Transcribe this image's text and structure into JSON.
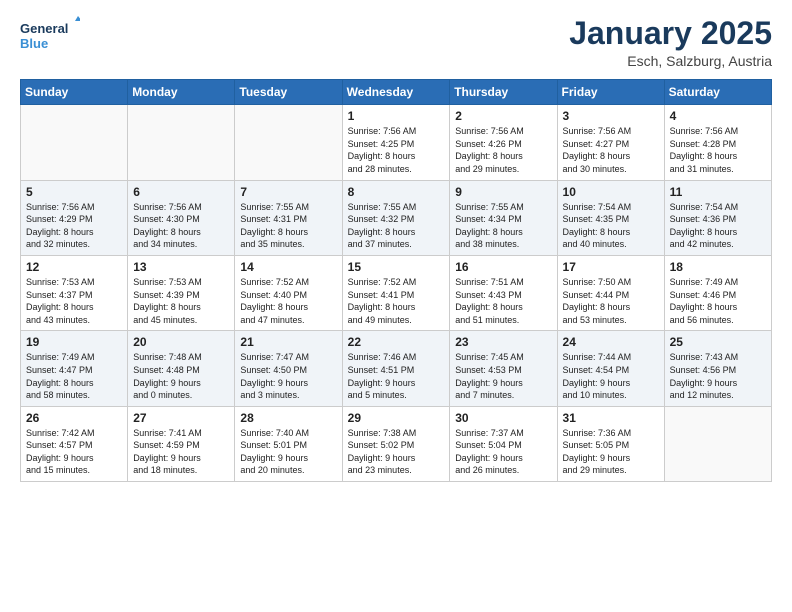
{
  "app": {
    "name_general": "General",
    "name_blue": "Blue",
    "month": "January 2025",
    "location": "Esch, Salzburg, Austria"
  },
  "weekdays": [
    "Sunday",
    "Monday",
    "Tuesday",
    "Wednesday",
    "Thursday",
    "Friday",
    "Saturday"
  ],
  "weeks": [
    [
      {
        "day": "",
        "info": ""
      },
      {
        "day": "",
        "info": ""
      },
      {
        "day": "",
        "info": ""
      },
      {
        "day": "1",
        "info": "Sunrise: 7:56 AM\nSunset: 4:25 PM\nDaylight: 8 hours\nand 28 minutes."
      },
      {
        "day": "2",
        "info": "Sunrise: 7:56 AM\nSunset: 4:26 PM\nDaylight: 8 hours\nand 29 minutes."
      },
      {
        "day": "3",
        "info": "Sunrise: 7:56 AM\nSunset: 4:27 PM\nDaylight: 8 hours\nand 30 minutes."
      },
      {
        "day": "4",
        "info": "Sunrise: 7:56 AM\nSunset: 4:28 PM\nDaylight: 8 hours\nand 31 minutes."
      }
    ],
    [
      {
        "day": "5",
        "info": "Sunrise: 7:56 AM\nSunset: 4:29 PM\nDaylight: 8 hours\nand 32 minutes."
      },
      {
        "day": "6",
        "info": "Sunrise: 7:56 AM\nSunset: 4:30 PM\nDaylight: 8 hours\nand 34 minutes."
      },
      {
        "day": "7",
        "info": "Sunrise: 7:55 AM\nSunset: 4:31 PM\nDaylight: 8 hours\nand 35 minutes."
      },
      {
        "day": "8",
        "info": "Sunrise: 7:55 AM\nSunset: 4:32 PM\nDaylight: 8 hours\nand 37 minutes."
      },
      {
        "day": "9",
        "info": "Sunrise: 7:55 AM\nSunset: 4:34 PM\nDaylight: 8 hours\nand 38 minutes."
      },
      {
        "day": "10",
        "info": "Sunrise: 7:54 AM\nSunset: 4:35 PM\nDaylight: 8 hours\nand 40 minutes."
      },
      {
        "day": "11",
        "info": "Sunrise: 7:54 AM\nSunset: 4:36 PM\nDaylight: 8 hours\nand 42 minutes."
      }
    ],
    [
      {
        "day": "12",
        "info": "Sunrise: 7:53 AM\nSunset: 4:37 PM\nDaylight: 8 hours\nand 43 minutes."
      },
      {
        "day": "13",
        "info": "Sunrise: 7:53 AM\nSunset: 4:39 PM\nDaylight: 8 hours\nand 45 minutes."
      },
      {
        "day": "14",
        "info": "Sunrise: 7:52 AM\nSunset: 4:40 PM\nDaylight: 8 hours\nand 47 minutes."
      },
      {
        "day": "15",
        "info": "Sunrise: 7:52 AM\nSunset: 4:41 PM\nDaylight: 8 hours\nand 49 minutes."
      },
      {
        "day": "16",
        "info": "Sunrise: 7:51 AM\nSunset: 4:43 PM\nDaylight: 8 hours\nand 51 minutes."
      },
      {
        "day": "17",
        "info": "Sunrise: 7:50 AM\nSunset: 4:44 PM\nDaylight: 8 hours\nand 53 minutes."
      },
      {
        "day": "18",
        "info": "Sunrise: 7:49 AM\nSunset: 4:46 PM\nDaylight: 8 hours\nand 56 minutes."
      }
    ],
    [
      {
        "day": "19",
        "info": "Sunrise: 7:49 AM\nSunset: 4:47 PM\nDaylight: 8 hours\nand 58 minutes."
      },
      {
        "day": "20",
        "info": "Sunrise: 7:48 AM\nSunset: 4:48 PM\nDaylight: 9 hours\nand 0 minutes."
      },
      {
        "day": "21",
        "info": "Sunrise: 7:47 AM\nSunset: 4:50 PM\nDaylight: 9 hours\nand 3 minutes."
      },
      {
        "day": "22",
        "info": "Sunrise: 7:46 AM\nSunset: 4:51 PM\nDaylight: 9 hours\nand 5 minutes."
      },
      {
        "day": "23",
        "info": "Sunrise: 7:45 AM\nSunset: 4:53 PM\nDaylight: 9 hours\nand 7 minutes."
      },
      {
        "day": "24",
        "info": "Sunrise: 7:44 AM\nSunset: 4:54 PM\nDaylight: 9 hours\nand 10 minutes."
      },
      {
        "day": "25",
        "info": "Sunrise: 7:43 AM\nSunset: 4:56 PM\nDaylight: 9 hours\nand 12 minutes."
      }
    ],
    [
      {
        "day": "26",
        "info": "Sunrise: 7:42 AM\nSunset: 4:57 PM\nDaylight: 9 hours\nand 15 minutes."
      },
      {
        "day": "27",
        "info": "Sunrise: 7:41 AM\nSunset: 4:59 PM\nDaylight: 9 hours\nand 18 minutes."
      },
      {
        "day": "28",
        "info": "Sunrise: 7:40 AM\nSunset: 5:01 PM\nDaylight: 9 hours\nand 20 minutes."
      },
      {
        "day": "29",
        "info": "Sunrise: 7:38 AM\nSunset: 5:02 PM\nDaylight: 9 hours\nand 23 minutes."
      },
      {
        "day": "30",
        "info": "Sunrise: 7:37 AM\nSunset: 5:04 PM\nDaylight: 9 hours\nand 26 minutes."
      },
      {
        "day": "31",
        "info": "Sunrise: 7:36 AM\nSunset: 5:05 PM\nDaylight: 9 hours\nand 29 minutes."
      },
      {
        "day": "",
        "info": ""
      }
    ]
  ]
}
